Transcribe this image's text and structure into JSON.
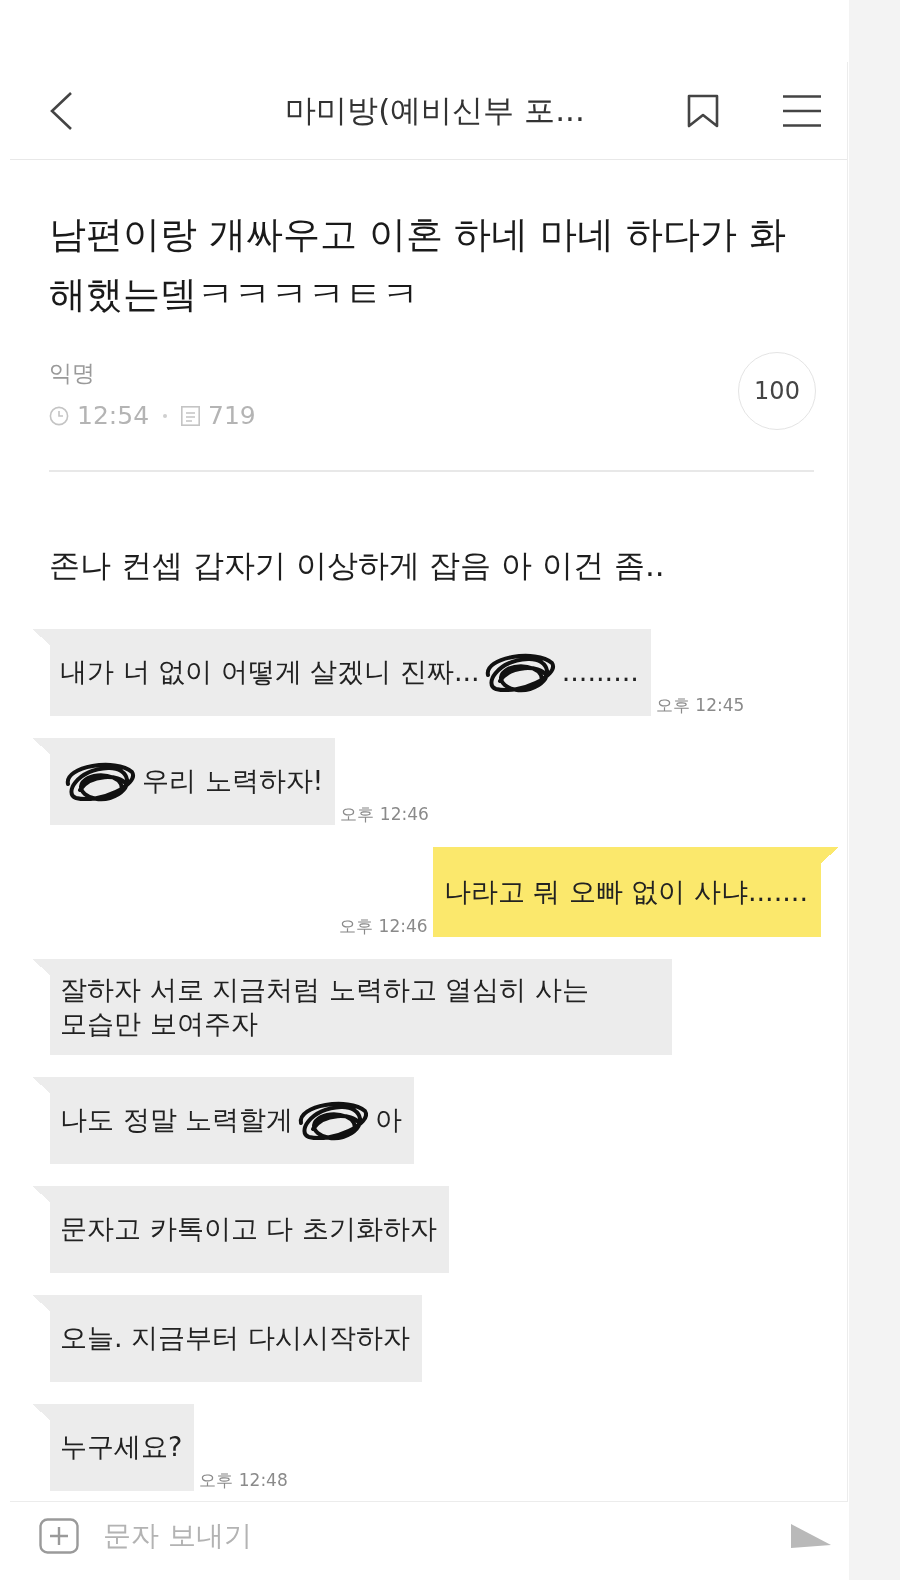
{
  "header": {
    "title": "마미방(예비신부 포..."
  },
  "post": {
    "title": "남편이랑 개싸우고 이혼 하네 마네 하다가 화해했는뎈ㅋㅋㅋㅋㅌㅋ",
    "author": "익명",
    "time": "12:54",
    "views": "719",
    "count": "100",
    "body": "존나 컨셉 갑자기 이상하게 잡음 아 이건 좀.."
  },
  "chat": {
    "messages": [
      {
        "kind": "received",
        "parts": [
          {
            "kind": "text",
            "text": "내가 너 없이 어떻게 살겠니 진짜..."
          },
          {
            "kind": "scribble"
          },
          {
            "kind": "text",
            "text": "........."
          }
        ],
        "time": "오후 12:45"
      },
      {
        "kind": "received",
        "parts": [
          {
            "kind": "scribble"
          },
          {
            "kind": "text",
            "text": "우리 노력하자!"
          }
        ],
        "time": "오후 12:46"
      },
      {
        "kind": "sent",
        "parts": [
          {
            "kind": "text",
            "text": "나라고 뭐 오빠 없이 사냐......."
          }
        ],
        "time": "오후 12:46"
      },
      {
        "kind": "received",
        "parts": [
          {
            "kind": "text",
            "text": "잘하자 서로 지금처럼 노력하고 열심히 사는 모습만 보여주자"
          }
        ]
      },
      {
        "kind": "received",
        "parts": [
          {
            "kind": "text",
            "text": "나도 정말 노력할게"
          },
          {
            "kind": "scribble"
          },
          {
            "kind": "text",
            "text": "아"
          }
        ]
      },
      {
        "kind": "received",
        "parts": [
          {
            "kind": "text",
            "text": "문자고 카톡이고 다 초기화하자"
          }
        ]
      },
      {
        "kind": "received",
        "parts": [
          {
            "kind": "text",
            "text": "오늘. 지금부터 다시시작하자"
          }
        ]
      },
      {
        "kind": "received",
        "parts": [
          {
            "kind": "text",
            "text": "누구세요?"
          }
        ],
        "time": "오후 12:48"
      }
    ]
  },
  "composer": {
    "placeholder": "문자 보내기"
  }
}
